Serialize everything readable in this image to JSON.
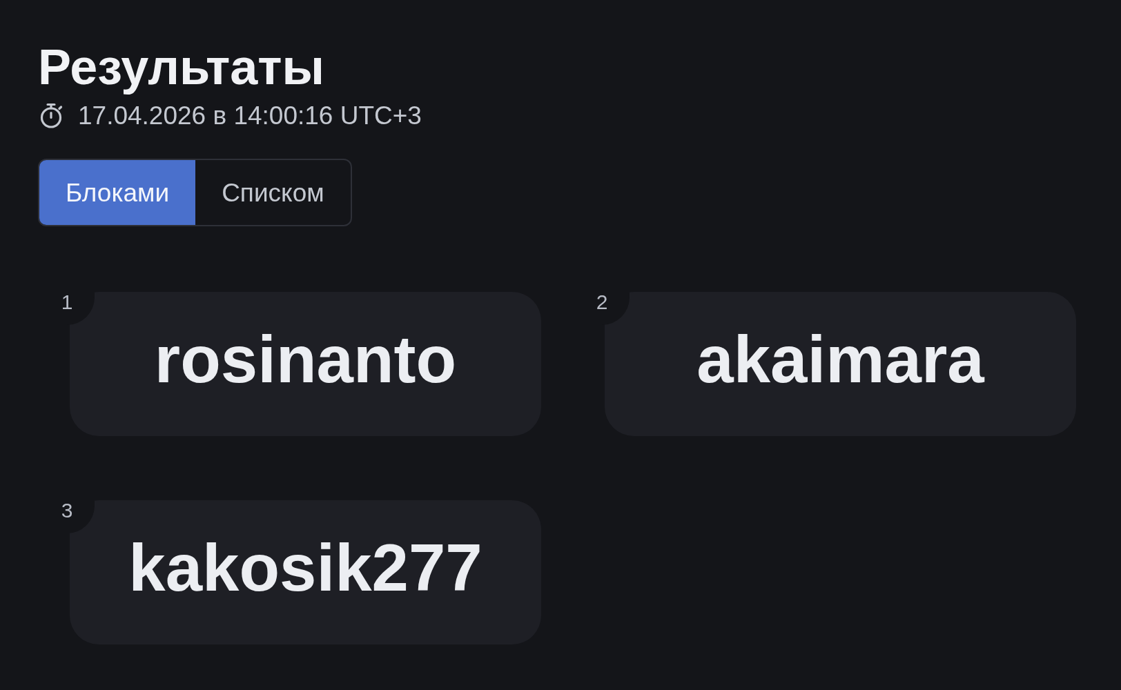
{
  "page": {
    "title": "Результаты",
    "timestamp": "17.04.2026 в 14:00:16 UTC+3"
  },
  "view_tabs": [
    {
      "label": "Блоками",
      "selected": true
    },
    {
      "label": "Списком",
      "selected": false
    }
  ],
  "results": [
    {
      "rank": "1",
      "name": "rosinanto"
    },
    {
      "rank": "2",
      "name": "akaimara"
    },
    {
      "rank": "3",
      "name": "kakosik277"
    }
  ]
}
